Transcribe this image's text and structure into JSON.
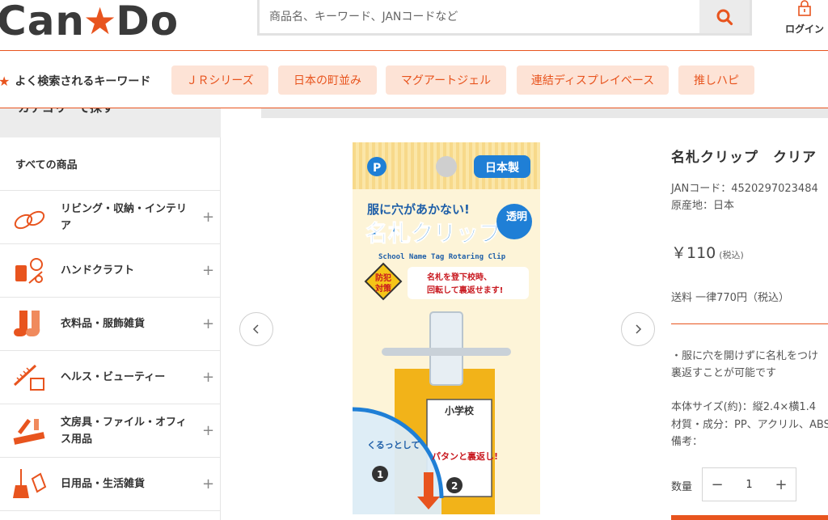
{
  "header": {
    "logo_left": "Can",
    "logo_right": "Do",
    "search_placeholder": "商品名、キーワード、JANコードなど",
    "login_label": "ログイン"
  },
  "keywords": {
    "title": "よく検索されるキーワード",
    "items": [
      "ＪＲシリーズ",
      "日本の町並み",
      "マグアートジェル",
      "連結ディスプレイベース",
      "推しハピ"
    ]
  },
  "sidebar": {
    "heading": "カテゴリーで探す",
    "all_products": "すべての商品",
    "categories": [
      {
        "label": "リビング・収納・インテリア",
        "icon": "slippers-icon"
      },
      {
        "label": "ハンドクラフト",
        "icon": "sewing-icon"
      },
      {
        "label": "衣料品・服飾雑貨",
        "icon": "socks-icon"
      },
      {
        "label": "ヘルス・ビューティー",
        "icon": "comb-icon"
      },
      {
        "label": "文房具・ファイル・オフィス用品",
        "icon": "stationery-icon"
      },
      {
        "label": "日用品・生活雑貨",
        "icon": "broom-icon"
      }
    ]
  },
  "product": {
    "name": "名札クリップ　クリア",
    "jan": "JANコード：4520297023484",
    "origin": "原産地：日本",
    "price": "￥110",
    "tax": "(税込)",
    "shipping": "送料 一律770円（税込）",
    "desc1": "・服に穴を開けずに名札をつけ",
    "desc2": "裏返すことが可能です",
    "size": "本体サイズ(約)：縦2.4×横1.4",
    "material": "材質・成分：PP、アクリル、ABS",
    "note": "備考：",
    "qty_label": "数量",
    "qty_value": "1"
  },
  "package": {
    "made_in": "日本製",
    "catch": "服に穴があかない!",
    "title": "名札クリップ",
    "clear": "透明",
    "english": "School Name Tag Rotaring Clip",
    "badge": "防犯対策",
    "badge_l1": "防犯",
    "badge_l2": "対策",
    "tip1": "名札を登下校時、",
    "tip2": "回転して裏返せます!",
    "school": "小学校",
    "step1": "くるっとして",
    "step2": "パタンと裏返し!"
  },
  "colors": {
    "accent": "#e8541e",
    "chip_bg": "#fde3d6",
    "package_bg": "#fbe6a8",
    "package_blue": "#1f7fd6"
  }
}
